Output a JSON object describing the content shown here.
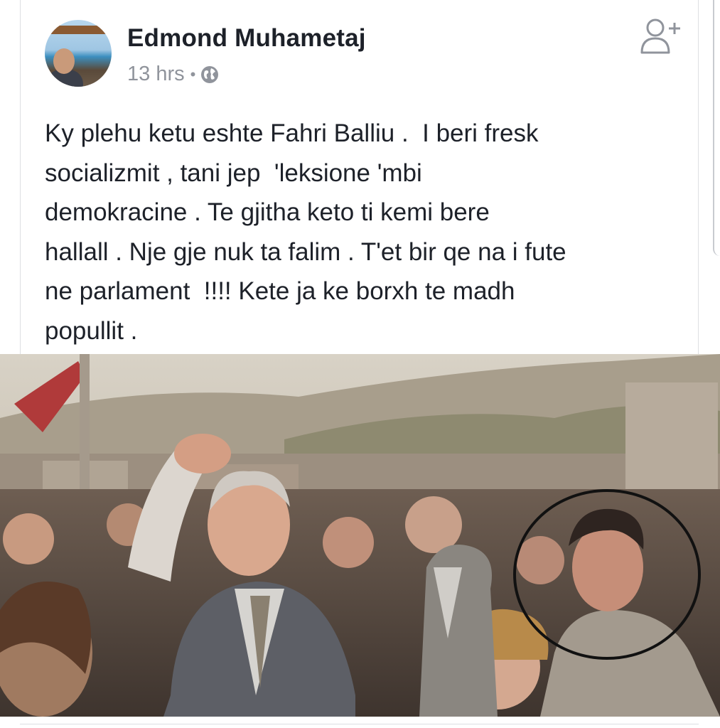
{
  "post": {
    "author": "Edmond Muhametaj",
    "time": "13 hrs",
    "separator": "•",
    "privacy_icon": "globe-icon",
    "action_icon": "add-friend-icon",
    "text_lines": [
      "Ky plehu ketu eshte Fahri Balliu .  I beri fresk",
      "socializmit , tani jep  'leksione 'mbi",
      "demokracine . Te gjitha keto ti kemi bere",
      "hallall . Nje gje nuk ta falim . T'et bir qe na i fute",
      "ne parlament  !!!! Kete ja ke borxh te madh",
      "popullit ."
    ]
  },
  "colors": {
    "name": "#1d2129",
    "meta": "#90949c",
    "icon": "#90949c",
    "highlight_circle": "#111111"
  }
}
